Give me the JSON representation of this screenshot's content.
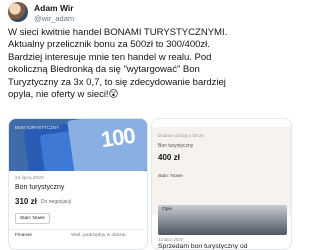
{
  "author": {
    "name": "Adam Wir",
    "handle": "@wir_adam"
  },
  "tweet": {
    "text": "W sieci kwitnie handel BONAMI TURYSTYCZNYMI.\nAktualny przelicznik bonu za 500zł to 300/400zł.\nBardziej interesuje mnie ten handel w realu. Pod\nokoliczną Biedronką da się \"wytargować\" Bon\nTuryztyczny za 3x 0,7, to się zdecydowanie bardziej\nopyla, nie oferty w sieci!😲"
  },
  "listing_left": {
    "image_brand": "BON TURYSTYCZNY",
    "image_number": "100",
    "date": "24 lipca 2020",
    "title": "Bon turystyczny",
    "price": "310 zł",
    "negotiable": "Do negocjacji",
    "condition": "Stan: Nowe",
    "seller": "Finanse",
    "location": "Wiel. podrzędny w obszar"
  },
  "listing_right": {
    "header_date": "Dodane dzisiaj o 09:26",
    "title": "Bon turystyczny",
    "price": "400 zł",
    "status": "Stan: Nowe",
    "section_label": "Opis",
    "date": "23 lipca 2020",
    "title2": "Sprzedam bon turystyczny od"
  }
}
